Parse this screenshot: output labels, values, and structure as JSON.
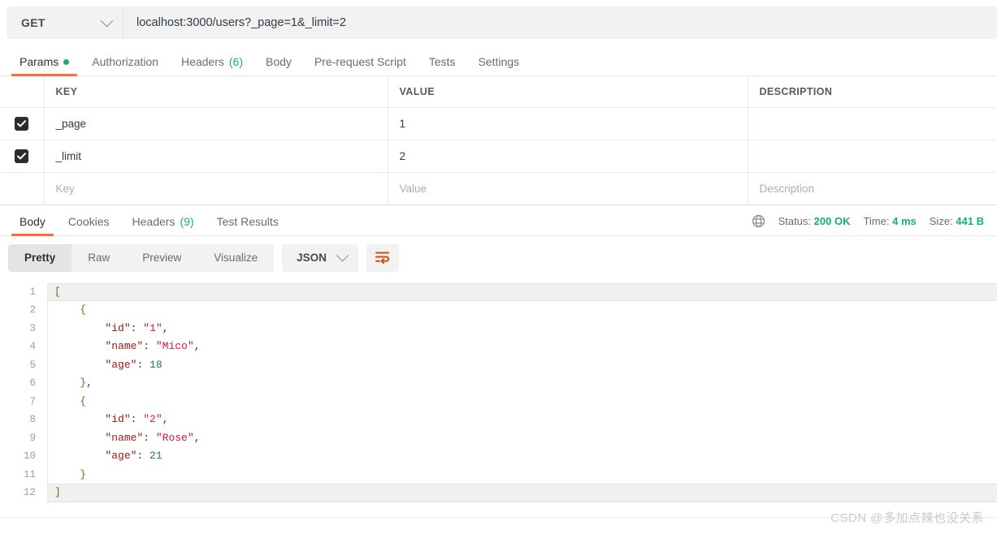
{
  "request": {
    "method": "GET",
    "url": "localhost:3000/users?_page=1&_limit=2",
    "tabs": [
      {
        "label": "Params",
        "badge": "",
        "dot": true,
        "active": true
      },
      {
        "label": "Authorization",
        "badge": "",
        "dot": false,
        "active": false
      },
      {
        "label": "Headers",
        "badge": "(6)",
        "dot": false,
        "active": false
      },
      {
        "label": "Body",
        "badge": "",
        "dot": false,
        "active": false
      },
      {
        "label": "Pre-request Script",
        "badge": "",
        "dot": false,
        "active": false
      },
      {
        "label": "Tests",
        "badge": "",
        "dot": false,
        "active": false
      },
      {
        "label": "Settings",
        "badge": "",
        "dot": false,
        "active": false
      }
    ]
  },
  "params": {
    "headers": {
      "key": "KEY",
      "value": "VALUE",
      "description": "DESCRIPTION"
    },
    "rows": [
      {
        "checked": true,
        "key": "_page",
        "value": "1",
        "description": ""
      },
      {
        "checked": true,
        "key": "_limit",
        "value": "2",
        "description": ""
      }
    ],
    "placeholders": {
      "key": "Key",
      "value": "Value",
      "description": "Description"
    }
  },
  "response": {
    "tabs": [
      {
        "label": "Body",
        "badge": "",
        "active": true
      },
      {
        "label": "Cookies",
        "badge": "",
        "active": false
      },
      {
        "label": "Headers",
        "badge": "(9)",
        "active": false
      },
      {
        "label": "Test Results",
        "badge": "",
        "active": false
      }
    ],
    "meta": {
      "status_label": "Status:",
      "status_value": "200 OK",
      "time_label": "Time:",
      "time_value": "4 ms",
      "size_label": "Size:",
      "size_value": "441 B"
    },
    "toolbar": {
      "views": [
        "Pretty",
        "Raw",
        "Preview",
        "Visualize"
      ],
      "active_view": "Pretty",
      "format": "JSON"
    },
    "body_lines": [
      {
        "n": "1",
        "indent": 0,
        "tokens": [
          {
            "t": "brk",
            "v": "["
          }
        ],
        "hl": true
      },
      {
        "n": "2",
        "indent": 1,
        "tokens": [
          {
            "t": "brk",
            "v": "{"
          }
        ],
        "hl": false
      },
      {
        "n": "3",
        "indent": 2,
        "tokens": [
          {
            "t": "key",
            "v": "\"id\""
          },
          {
            "t": "punc",
            "v": ": "
          },
          {
            "t": "str",
            "v": "\"1\""
          },
          {
            "t": "punc",
            "v": ","
          }
        ],
        "hl": false
      },
      {
        "n": "4",
        "indent": 2,
        "tokens": [
          {
            "t": "key",
            "v": "\"name\""
          },
          {
            "t": "punc",
            "v": ": "
          },
          {
            "t": "str",
            "v": "\"Mico\""
          },
          {
            "t": "punc",
            "v": ","
          }
        ],
        "hl": false
      },
      {
        "n": "5",
        "indent": 2,
        "tokens": [
          {
            "t": "key",
            "v": "\"age\""
          },
          {
            "t": "punc",
            "v": ": "
          },
          {
            "t": "num",
            "v": "18"
          }
        ],
        "hl": false
      },
      {
        "n": "6",
        "indent": 1,
        "tokens": [
          {
            "t": "brk",
            "v": "}"
          },
          {
            "t": "punc",
            "v": ","
          }
        ],
        "hl": false
      },
      {
        "n": "7",
        "indent": 1,
        "tokens": [
          {
            "t": "brk",
            "v": "{"
          }
        ],
        "hl": false
      },
      {
        "n": "8",
        "indent": 2,
        "tokens": [
          {
            "t": "key",
            "v": "\"id\""
          },
          {
            "t": "punc",
            "v": ": "
          },
          {
            "t": "str",
            "v": "\"2\""
          },
          {
            "t": "punc",
            "v": ","
          }
        ],
        "hl": false
      },
      {
        "n": "9",
        "indent": 2,
        "tokens": [
          {
            "t": "key",
            "v": "\"name\""
          },
          {
            "t": "punc",
            "v": ": "
          },
          {
            "t": "str",
            "v": "\"Rose\""
          },
          {
            "t": "punc",
            "v": ","
          }
        ],
        "hl": false
      },
      {
        "n": "10",
        "indent": 2,
        "tokens": [
          {
            "t": "key",
            "v": "\"age\""
          },
          {
            "t": "punc",
            "v": ": "
          },
          {
            "t": "num",
            "v": "21"
          }
        ],
        "hl": false
      },
      {
        "n": "11",
        "indent": 1,
        "tokens": [
          {
            "t": "brk",
            "v": "}"
          }
        ],
        "hl": false
      },
      {
        "n": "12",
        "indent": 0,
        "tokens": [
          {
            "t": "brk",
            "v": "]"
          }
        ],
        "hl": true
      }
    ]
  },
  "watermark": "CSDN @多加点辣也没关系",
  "colors": {
    "accent": "#ff6c37",
    "success": "#17b26a",
    "checkbox": "#2c2c2c",
    "json_key": "#a31515",
    "json_string": "#d14",
    "json_number": "#1a7f37"
  }
}
